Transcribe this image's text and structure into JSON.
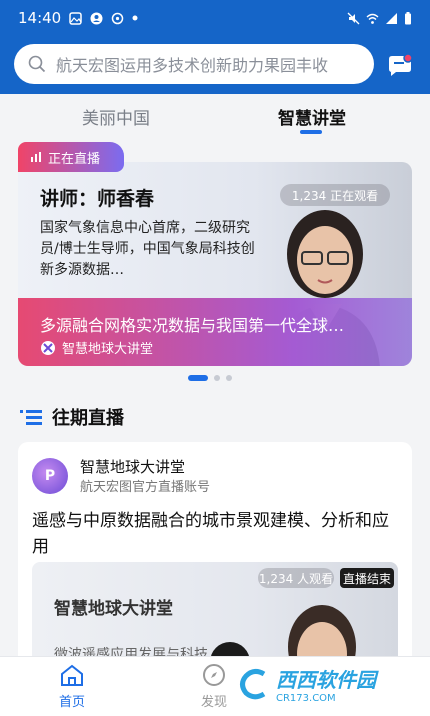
{
  "status": {
    "time": "14:40"
  },
  "search": {
    "placeholder": "航天宏图运用多技术创新助力果园丰收"
  },
  "tabs": [
    {
      "label": "美丽中国"
    },
    {
      "label": "智慧讲堂"
    }
  ],
  "live_card": {
    "tag": "正在直播",
    "teacher": "讲师：师香春",
    "description": "国家气象信息中心首席，二级研究员/博士生导师，中国气象局科技创新多源数据…",
    "viewers": "1,234 正在观看",
    "title": "多源融合网格实况数据与我国第一代全球…",
    "source": "智慧地球大讲堂"
  },
  "section": {
    "title": "往期直播"
  },
  "feed": {
    "account_name": "智慧地球大讲堂",
    "account_sub": "航天宏图官方直播账号",
    "title": "遥感与中原数据融合的城市景观建模、分析和应用",
    "thumb_viewers": "1,234 人观看",
    "thumb_status": "直播结束",
    "thumb_title": "智慧地球大讲堂",
    "thumb_sub": "微波遥感应用发展与科技"
  },
  "tabbar": [
    {
      "label": "首页"
    },
    {
      "label": "发现"
    }
  ],
  "watermark": {
    "text": "西西软件园",
    "sub": "CR173.COM"
  },
  "colors": {
    "brand": "#1565c8",
    "accent": "#1e6ee6",
    "live_start": "#f04468",
    "live_end": "#7b6cf0"
  }
}
